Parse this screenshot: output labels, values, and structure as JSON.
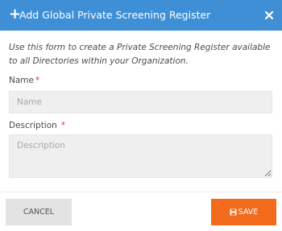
{
  "modal": {
    "title": "Add Global Private Screening Register",
    "header_color": "#3f8fd6",
    "icons": {
      "title": "plus-icon",
      "close": "close-icon",
      "save": "save-icon"
    }
  },
  "intro_text": "Use this form to create a Private Screening Register available to all Directories within your Organization.",
  "form": {
    "name": {
      "label": "Name",
      "required_marker": "*",
      "placeholder": "Name",
      "value": ""
    },
    "description": {
      "label": "Description",
      "required_marker": "*",
      "placeholder": "Description",
      "value": ""
    }
  },
  "footer": {
    "cancel_label": "CANCEL",
    "save_label": "SAVE",
    "save_color": "#f26a1b"
  }
}
